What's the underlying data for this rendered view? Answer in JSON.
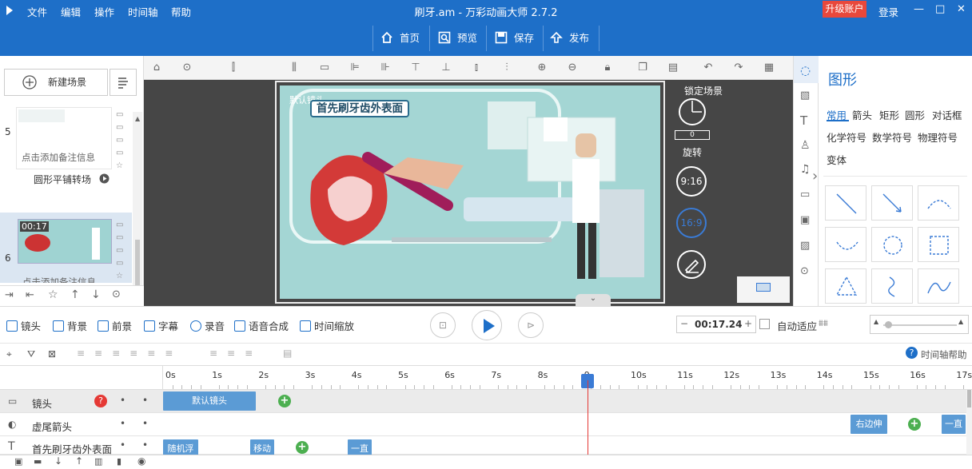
{
  "app": {
    "title": "刷牙.am - 万彩动画大师 2.7.2",
    "menu": [
      "文件",
      "编辑",
      "操作",
      "时间轴",
      "帮助"
    ],
    "upgrade_label": "升级账户",
    "login_label": "登录"
  },
  "toolbar": {
    "home": "首页",
    "preview": "预览",
    "save": "保存",
    "publish": "发布"
  },
  "left_panel": {
    "new_scene": "新建场景",
    "scenes": [
      {
        "number": "5",
        "note": "点击添加备注信息",
        "transition": "圆形平铺转场"
      },
      {
        "number": "6",
        "note": "点击添加备注信息",
        "duration": "00:17"
      }
    ]
  },
  "canvas": {
    "lock_scene": "锁定场景",
    "rotate_value": "0",
    "rotate_label": "旋转",
    "ratio_916": "9:16",
    "ratio_169": "16:9",
    "stage_camera_label": "默认镜头",
    "stage_title": "首先刷牙齿外表面"
  },
  "right_panel": {
    "title": "图形",
    "tabs_row1": [
      "常用",
      "箭头",
      "矩形",
      "圆形",
      "对话框"
    ],
    "tabs_row2": [
      "化学符号",
      "数学符号",
      "物理符号"
    ],
    "tabs_row3": [
      "变体"
    ]
  },
  "timeline_bar": {
    "camera": "镜头",
    "background": "背景",
    "foreground": "前景",
    "subtitle": "字幕",
    "record": "录音",
    "tts": "语音合成",
    "time_scale": "时间缩放",
    "time_value": "00:17.24",
    "auto_fit": "自动适应",
    "help": "时间轴帮助"
  },
  "ruler": {
    "ticks": [
      "0s",
      "1s",
      "2s",
      "3s",
      "4s",
      "5s",
      "6s",
      "7s",
      "8s",
      "9",
      "10s",
      "11s",
      "12s",
      "13s",
      "14s",
      "15s",
      "16s",
      "17s"
    ]
  },
  "tracks": [
    {
      "label": "镜头",
      "clips": [
        "默认镜头"
      ]
    },
    {
      "label": "虚尾箭头",
      "clips": [
        "右边伸",
        "一直"
      ]
    },
    {
      "label": "首先刷牙齿外表面",
      "clips": [
        "随机浮",
        "移动",
        "一直"
      ]
    }
  ],
  "colors": {
    "brand": "#1e6fc8",
    "upgrade": "#e8483c",
    "clip": "#5b9bd5",
    "add": "#4caf50",
    "playhead": "#e53935"
  }
}
